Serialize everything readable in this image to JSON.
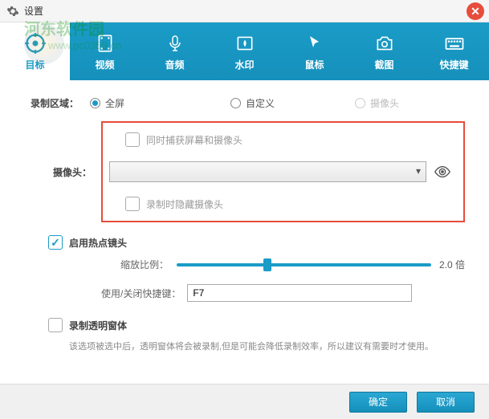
{
  "titlebar": {
    "title": "设置"
  },
  "tabs": [
    {
      "label": "目标"
    },
    {
      "label": "视频"
    },
    {
      "label": "音频"
    },
    {
      "label": "水印"
    },
    {
      "label": "鼠标"
    },
    {
      "label": "截图"
    },
    {
      "label": "快捷键"
    }
  ],
  "recordArea": {
    "label": "录制区域：",
    "options": [
      {
        "label": "全屏",
        "checked": true
      },
      {
        "label": "自定义",
        "checked": false
      },
      {
        "label": "摄像头",
        "checked": false,
        "disabled": true
      }
    ]
  },
  "checkboxes": {
    "captureBoth": "同时捕获屏幕和摄像头",
    "hideCamera": "录制时隐藏摄像头",
    "hotspot": "启用热点镜头",
    "transparent": "录制透明窗体"
  },
  "camera": {
    "label": "摄像头："
  },
  "zoom": {
    "label": "缩放比例：",
    "value": "2.0 倍"
  },
  "hotkey": {
    "label": "使用/关闭快捷键：",
    "value": "F7"
  },
  "transparentDesc": "该选项被选中后，透明窗体将会被录制,但是可能会降低录制效率，所以建议有需要时才使用。",
  "buttons": {
    "ok": "确定",
    "cancel": "取消"
  }
}
